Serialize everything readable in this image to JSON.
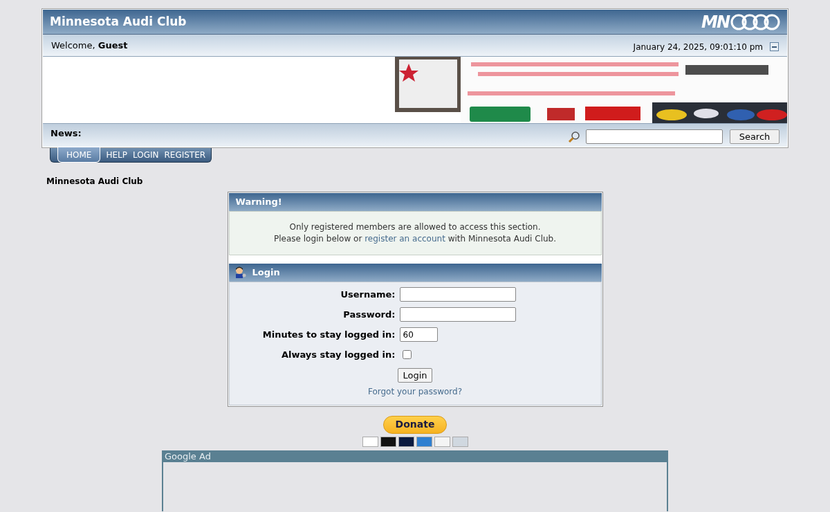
{
  "header": {
    "title": "Minnesota Audi Club",
    "logo_text": "MN",
    "welcome_prefix": "Welcome,",
    "welcome_name": "Guest",
    "datetime": "January 24, 2025, 09:01:10 pm",
    "news_label": "News:",
    "search": {
      "button": "Search"
    }
  },
  "menu": [
    {
      "label": "HOME",
      "selected": true
    },
    {
      "label": "HELP",
      "selected": false
    },
    {
      "label": "LOGIN",
      "selected": false
    },
    {
      "label": "REGISTER",
      "selected": false
    }
  ],
  "breadcrumb": "Minnesota Audi Club",
  "warning": {
    "title": "Warning!",
    "line1": "Only registered members are allowed to access this section.",
    "line2_before": "Please login below or",
    "link": "register an account",
    "line2_after": "with Minnesota Audi Club."
  },
  "login": {
    "title": "Login",
    "fields": [
      {
        "kind": "text",
        "label": "Username:"
      },
      {
        "kind": "password",
        "label": "Password:"
      },
      {
        "kind": "minutes",
        "label": "Minutes to stay logged in:",
        "value": "60"
      },
      {
        "kind": "checkbox",
        "label": "Always stay logged in:",
        "checked": false
      }
    ],
    "button": "Login",
    "forgot": "Forgot your password?"
  },
  "donate": {
    "button": "Donate",
    "cards": [
      {
        "color": "#ffffff"
      },
      {
        "color": "#111111"
      },
      {
        "color": "#0b1a40"
      },
      {
        "color": "#2f7fd0"
      },
      {
        "color": "#f4f4f4"
      },
      {
        "color": "#d0d8e0"
      }
    ]
  },
  "ad": {
    "title": "Google Ad"
  }
}
